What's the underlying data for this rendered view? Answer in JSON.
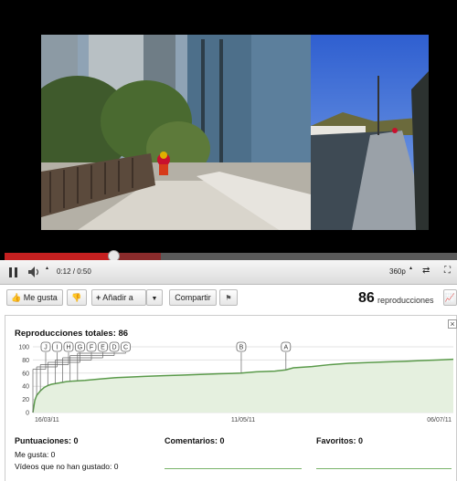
{
  "player": {
    "time_display": "0:12 / 0:50",
    "quality": "360p",
    "progress_fraction": 0.24,
    "buffered_fraction": 0.345
  },
  "actions": {
    "like_label": "Me gusta",
    "add_label": "Añadir a",
    "share_label": "Compartir",
    "view_count": "86",
    "views_label": "reproducciones"
  },
  "stats": {
    "title": "Reproducciones totales: 86",
    "close_glyph": "×",
    "ratings_title": "Puntuaciones: 0",
    "likes_line": "Me gusta: 0",
    "dislikes_line": "Vídeos que no han gustado: 0",
    "comments_title": "Comentarios: 0",
    "favorites_title": "Favoritos: 0"
  },
  "chart_data": {
    "type": "area",
    "ylim": [
      0,
      100
    ],
    "yticks": [
      0,
      20,
      40,
      60,
      80,
      100
    ],
    "xticks": [
      "16/03/11",
      "11/05/11",
      "06/07/11"
    ],
    "grid": true,
    "color": "#5a9a4a",
    "fill": "#e5f0df",
    "series": [
      {
        "x": [
          0,
          0.5,
          1,
          2,
          3,
          4,
          5,
          7,
          9,
          11,
          14,
          18,
          22,
          26,
          30,
          35,
          40,
          45,
          50,
          56,
          60,
          65,
          68,
          70,
          75,
          80,
          85,
          90,
          95,
          100,
          104,
          109,
          113
        ],
        "values": [
          0,
          18,
          26,
          33,
          38,
          41,
          43,
          45,
          47,
          48,
          49,
          51,
          53,
          54,
          55,
          56,
          57,
          58,
          59,
          60,
          62,
          63,
          65,
          68,
          70,
          73,
          75,
          76,
          77,
          78,
          79,
          80,
          81
        ]
      }
    ],
    "annotations": [
      {
        "label": "J",
        "day": 0
      },
      {
        "label": "I",
        "day": 1
      },
      {
        "label": "H",
        "day": 2
      },
      {
        "label": "G",
        "day": 4
      },
      {
        "label": "F",
        "day": 6
      },
      {
        "label": "E",
        "day": 8
      },
      {
        "label": "D",
        "day": 10
      },
      {
        "label": "C",
        "day": 12
      },
      {
        "label": "B",
        "day": 56
      },
      {
        "label": "A",
        "day": 68
      }
    ]
  }
}
